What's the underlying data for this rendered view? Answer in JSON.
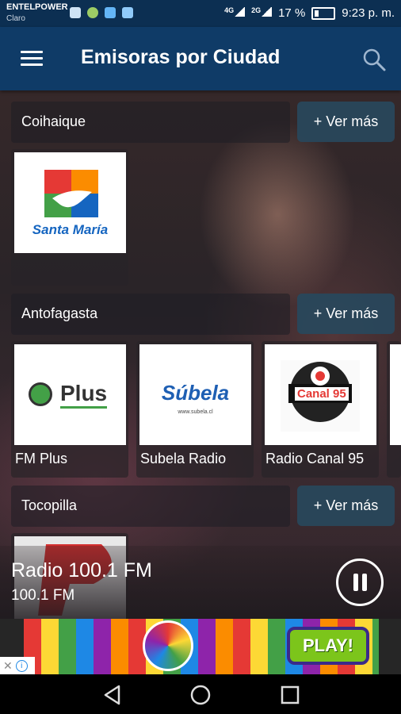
{
  "status_bar": {
    "carrier_primary": "ENTELPOWER",
    "carrier_secondary": "Claro",
    "network_1": "4G",
    "network_2": "2G",
    "battery": "17 %",
    "time": "9:23 p. m."
  },
  "app_bar": {
    "title": "Emisoras por Ciudad",
    "menu_icon": "hamburger-menu-icon",
    "search_icon": "search-icon"
  },
  "sections": [
    {
      "city": "Coihaique",
      "more_label": "+ Ver más",
      "stations": [
        {
          "name": "",
          "logo_text": "Santa María",
          "logo": "santa-maria-logo"
        }
      ]
    },
    {
      "city": "Antofagasta",
      "more_label": "+ Ver más",
      "stations": [
        {
          "name": "FM Plus",
          "logo_text": "Plus",
          "logo": "fm-plus-logo"
        },
        {
          "name": "Subela Radio",
          "logo_text": "Súbela",
          "logo_sub": "www.subela.cl",
          "logo": "subela-logo"
        },
        {
          "name": "Radio Canal 95",
          "logo_text": "Canal 95",
          "logo": "canal-95-logo"
        }
      ]
    },
    {
      "city": "Tocopilla",
      "more_label": "+ Ver más",
      "stations": []
    }
  ],
  "now_playing": {
    "title": "Radio 100.1 FM",
    "subtitle": "100.1 FM",
    "control_icon": "pause-icon"
  },
  "ad": {
    "cta": "PLAY!",
    "choice_icons": [
      "close-icon",
      "info-icon"
    ]
  },
  "nav_bar": {
    "icons": [
      "back-icon",
      "home-icon",
      "recents-icon"
    ]
  },
  "colors": {
    "status_bar": "#0c2f52",
    "app_bar": "#0f3b67",
    "ver_mas_button": "#28485c",
    "ad_play": "#7cc51b"
  }
}
